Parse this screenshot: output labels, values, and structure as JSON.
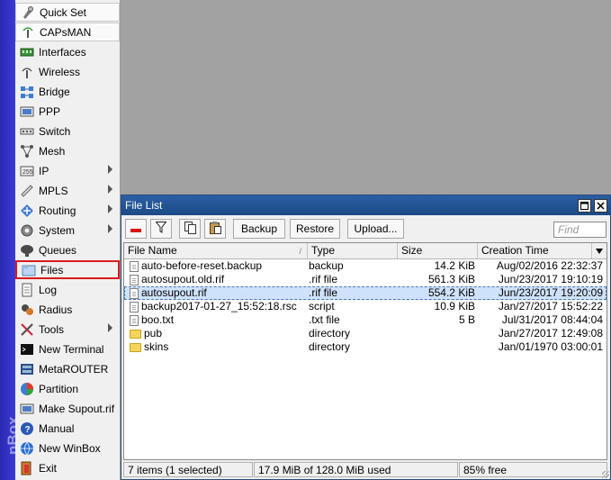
{
  "app": {
    "vertical_label": "nBox"
  },
  "sidebar": {
    "items": [
      {
        "label": "Quick Set",
        "icon": "quick-set-icon",
        "has_submenu": false
      },
      {
        "label": "CAPsMAN",
        "icon": "capsman-icon",
        "has_submenu": false
      },
      {
        "label": "Interfaces",
        "icon": "interfaces-icon",
        "has_submenu": false
      },
      {
        "label": "Wireless",
        "icon": "wireless-icon",
        "has_submenu": false
      },
      {
        "label": "Bridge",
        "icon": "bridge-icon",
        "has_submenu": false
      },
      {
        "label": "PPP",
        "icon": "ppp-icon",
        "has_submenu": false
      },
      {
        "label": "Switch",
        "icon": "switch-icon",
        "has_submenu": false
      },
      {
        "label": "Mesh",
        "icon": "mesh-icon",
        "has_submenu": false
      },
      {
        "label": "IP",
        "icon": "ip-icon",
        "has_submenu": true
      },
      {
        "label": "MPLS",
        "icon": "mpls-icon",
        "has_submenu": true
      },
      {
        "label": "Routing",
        "icon": "routing-icon",
        "has_submenu": true
      },
      {
        "label": "System",
        "icon": "system-icon",
        "has_submenu": true
      },
      {
        "label": "Queues",
        "icon": "queues-icon",
        "has_submenu": false
      },
      {
        "label": "Files",
        "icon": "files-icon",
        "has_submenu": false
      },
      {
        "label": "Log",
        "icon": "log-icon",
        "has_submenu": false
      },
      {
        "label": "Radius",
        "icon": "radius-icon",
        "has_submenu": false
      },
      {
        "label": "Tools",
        "icon": "tools-icon",
        "has_submenu": true
      },
      {
        "label": "New Terminal",
        "icon": "terminal-icon",
        "has_submenu": false
      },
      {
        "label": "MetaROUTER",
        "icon": "metarouter-icon",
        "has_submenu": false
      },
      {
        "label": "Partition",
        "icon": "partition-icon",
        "has_submenu": false
      },
      {
        "label": "Make Supout.rif",
        "icon": "supout-icon",
        "has_submenu": false
      },
      {
        "label": "Manual",
        "icon": "manual-icon",
        "has_submenu": false
      },
      {
        "label": "New WinBox",
        "icon": "new-winbox-icon",
        "has_submenu": false
      },
      {
        "label": "Exit",
        "icon": "exit-icon",
        "has_submenu": false
      }
    ],
    "selected": "Files"
  },
  "file_list": {
    "title": "File List",
    "toolbar": {
      "remove_icon": "minus-icon",
      "filter_icon": "filter-icon",
      "copy_icon": "copy-icon",
      "paste_icon": "paste-icon",
      "backup_label": "Backup",
      "restore_label": "Restore",
      "upload_label": "Upload...",
      "find_placeholder": "Find"
    },
    "columns": {
      "name": "File Name",
      "type": "Type",
      "size": "Size",
      "time": "Creation Time"
    },
    "rows": [
      {
        "name": "auto-before-reset.backup",
        "type": "backup",
        "size": "14.2 KiB",
        "time": "Aug/02/2016 22:32:37",
        "kind": "file",
        "selected": false
      },
      {
        "name": "autosupout.old.rif",
        "type": ".rif file",
        "size": "561.3 KiB",
        "time": "Jun/23/2017 19:10:19",
        "kind": "file",
        "selected": false
      },
      {
        "name": "autosupout.rif",
        "type": ".rif file",
        "size": "554.2 KiB",
        "time": "Jun/23/2017 19:20:09",
        "kind": "file",
        "selected": true
      },
      {
        "name": "backup2017-01-27_15:52:18.rsc",
        "type": "script",
        "size": "10.9 KiB",
        "time": "Jan/27/2017 15:52:22",
        "kind": "file",
        "selected": false
      },
      {
        "name": "boo.txt",
        "type": ".txt file",
        "size": "5 B",
        "time": "Jul/31/2017 08:44:04",
        "kind": "file",
        "selected": false
      },
      {
        "name": "pub",
        "type": "directory",
        "size": "",
        "time": "Jan/27/2017 12:49:08",
        "kind": "dir",
        "selected": false
      },
      {
        "name": "skins",
        "type": "directory",
        "size": "",
        "time": "Jan/01/1970 03:00:01",
        "kind": "dir",
        "selected": false
      }
    ],
    "status": {
      "items": "7 items (1 selected)",
      "usage": "17.9 MiB of 128.0 MiB used",
      "free": "85% free"
    }
  },
  "colors": {
    "accent_strip": "#2a2ab0",
    "titlebar": "#1c4a86",
    "selection_outline": "#d91a1a",
    "row_selected": "#cfe2fb"
  }
}
